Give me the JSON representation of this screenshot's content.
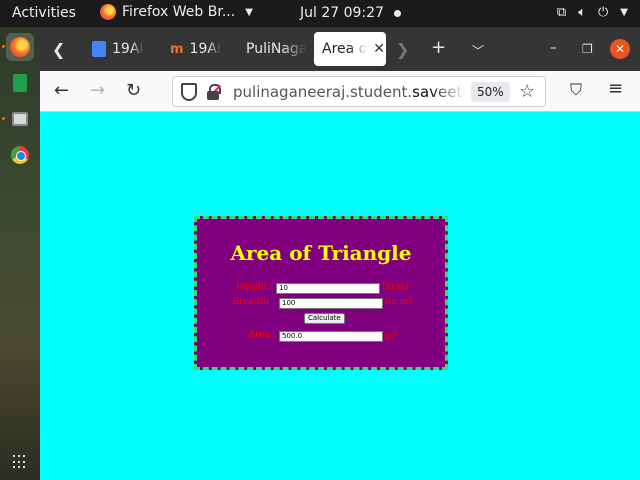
{
  "topbar": {
    "activities": "Activities",
    "app_name": "Firefox Web Br...",
    "clock": "Jul 27  09:27"
  },
  "dock": {
    "icons": [
      "firefox-icon",
      "spreadsheet-icon",
      "files-icon",
      "chrome-icon",
      "app-grid-icon"
    ]
  },
  "browser": {
    "tabs": [
      {
        "label": "19AI"
      },
      {
        "label": "19AI"
      },
      {
        "label": "PuliNaga"
      },
      {
        "label": "Area o",
        "active": true
      }
    ],
    "url_prefix": "pulinaganeeraj.student.",
    "url_host": "saveetha",
    "zoom": "50%"
  },
  "page": {
    "title": "Area of Triangle",
    "height_label": "Height :",
    "height_value": "10",
    "height_unit": "(in m)",
    "breadth_label": "Breadth :",
    "breadth_value": "100",
    "breadth_unit": "(in m)",
    "calculate_label": "Calculate",
    "area_label": "Area :",
    "area_value": "500.0",
    "area_unit": "m",
    "area_unit_exp": "2"
  },
  "colors": {
    "page_bg": "#00ffff",
    "card_bg": "#800080",
    "card_border": "#2ee36c",
    "title": "#ffff00",
    "label": "#ff0000"
  }
}
